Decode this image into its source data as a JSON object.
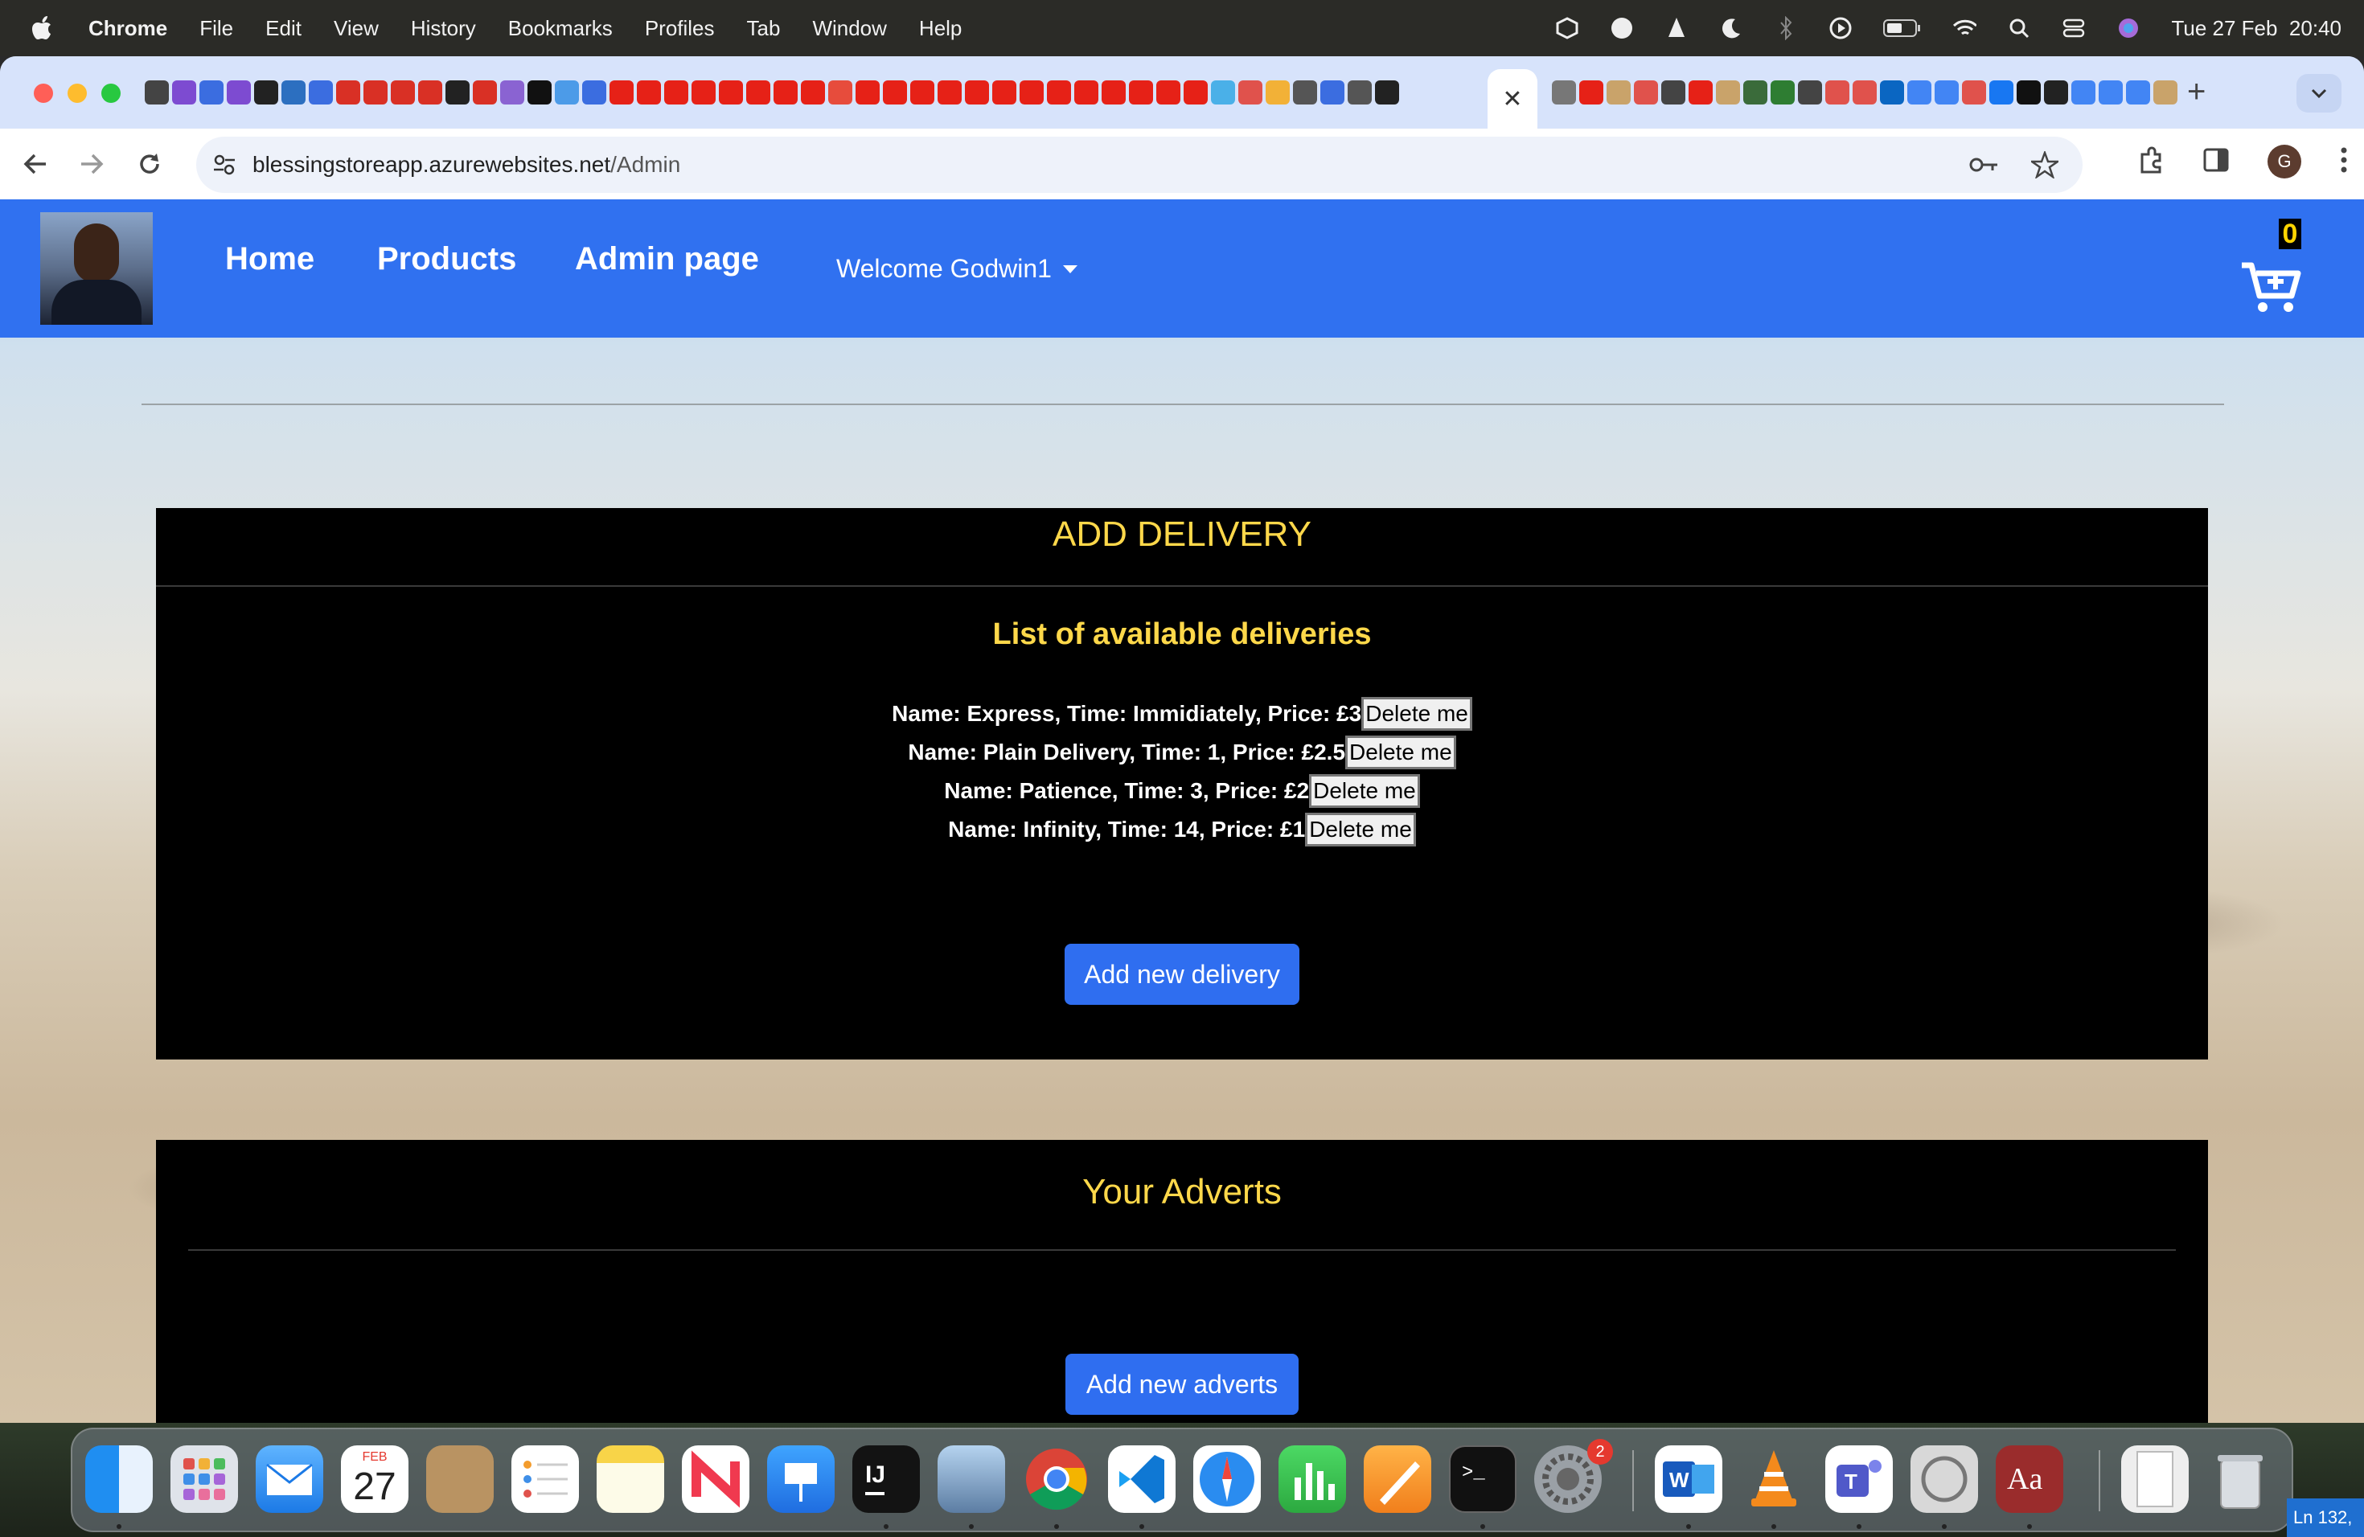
{
  "menubar": {
    "app_name": "Chrome",
    "items": [
      "File",
      "Edit",
      "View",
      "History",
      "Bookmarks",
      "Profiles",
      "Tab",
      "Window",
      "Help"
    ],
    "datetime": "Tue 27 Feb  20:40"
  },
  "browser": {
    "url_host": "blessingstoreapp.azurewebsites.net",
    "url_path": "/Admin",
    "active_tab_close": "✕",
    "new_tab": "+",
    "profile_initial": "G"
  },
  "site": {
    "nav": {
      "home": "Home",
      "products": "Products",
      "admin": "Admin page",
      "welcome": "Welcome Godwin1"
    },
    "cart_count": "0"
  },
  "delivery_panel": {
    "title": "ADD DELIVERY",
    "subtitle": "List of available deliveries",
    "items": [
      {
        "text": "Name: Express, Time: Immidiately, Price: £3",
        "button": "Delete me"
      },
      {
        "text": "Name: Plain Delivery, Time: 1, Price: £2.5",
        "button": "Delete me"
      },
      {
        "text": "Name: Patience, Time: 3, Price: £2",
        "button": "Delete me"
      },
      {
        "text": "Name: Infinity, Time: 14, Price: £1",
        "button": "Delete me"
      }
    ],
    "add_button": "Add new delivery"
  },
  "adverts_panel": {
    "title": "Your Adverts",
    "add_button": "Add new adverts"
  },
  "dock": {
    "calendar_month": "FEB",
    "calendar_day": "27",
    "settings_badge": "2"
  },
  "editor_status": "Ln 132,",
  "colors": {
    "nav_blue": "#3071f0",
    "panel_black": "#000000",
    "gold_text": "#ffd84a",
    "button_blue": "#2f6ef0"
  }
}
